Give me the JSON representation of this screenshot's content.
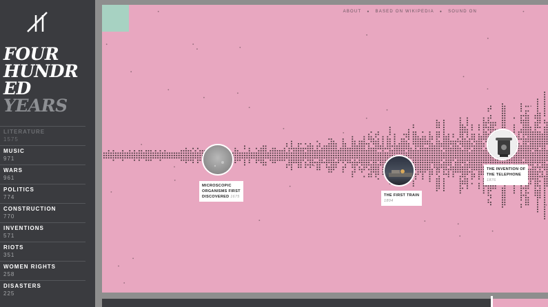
{
  "sidebar": {
    "title_lines": [
      "FOUR",
      "HUNDR",
      "ED"
    ],
    "title_last": "YEARS",
    "categories": [
      {
        "name": "LITERATURE",
        "count": "1575"
      },
      {
        "name": "MUSIC",
        "count": "971"
      },
      {
        "name": "WARS",
        "count": "961"
      },
      {
        "name": "POLITICS",
        "count": "774"
      },
      {
        "name": "CONSTRUCTION",
        "count": "770"
      },
      {
        "name": "INVENTIONS",
        "count": "571"
      },
      {
        "name": "RIOTS",
        "count": "351"
      },
      {
        "name": "WOMEN RIGHTS",
        "count": "258"
      },
      {
        "name": "DISASTERS",
        "count": "225"
      }
    ]
  },
  "topnav": {
    "about": "ABOUT",
    "source": "BASED ON WIKIPEDIA",
    "sound": "SOUND ON",
    "sep": "●"
  },
  "events": [
    {
      "title_1": "MICROSCOPIC",
      "title_2": "ORGANISMS FIRST",
      "title_3": "DISCOVERED",
      "year": "1675"
    },
    {
      "title_1": "THE FIRST TRAIN",
      "year": "1804"
    },
    {
      "title_1": "THE INVENTION OF",
      "title_2": "THE TELEPHONE",
      "year": "1876"
    }
  ],
  "colors": {
    "background": "#e8a7c0",
    "sidebar": "#3a3b3f",
    "accent": "#a7d2c2",
    "dots": "#4a3a40"
  },
  "icons": {
    "logo": "logo-icon"
  }
}
